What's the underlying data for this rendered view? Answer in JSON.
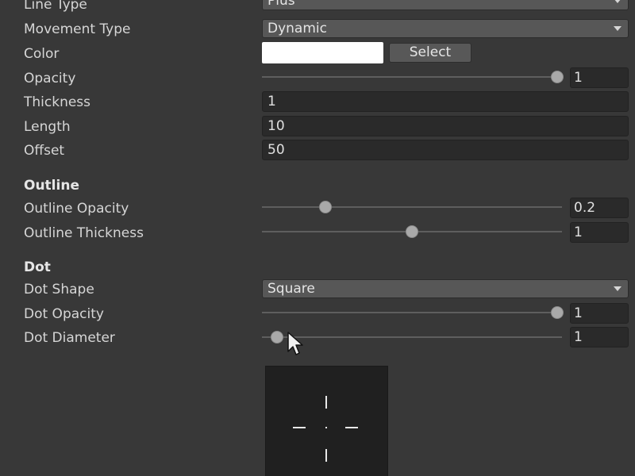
{
  "settings": {
    "line_type": {
      "label": "Line Type",
      "value": "Plus"
    },
    "movement_type": {
      "label": "Movement Type",
      "value": "Dynamic"
    },
    "color": {
      "label": "Color",
      "swatch": "#ffffff",
      "button": "Select"
    },
    "opacity": {
      "label": "Opacity",
      "value": "1",
      "level": 1.0
    },
    "thickness": {
      "label": "Thickness",
      "value": "1"
    },
    "length": {
      "label": "Length",
      "value": "10"
    },
    "offset": {
      "label": "Offset",
      "value": "50"
    }
  },
  "outline": {
    "heading": "Outline",
    "opacity": {
      "label": "Outline Opacity",
      "value": "0.2",
      "level": 0.2
    },
    "thickness": {
      "label": "Outline Thickness",
      "value": "1",
      "level": 0.5
    }
  },
  "dot": {
    "heading": "Dot",
    "shape": {
      "label": "Dot Shape",
      "value": "Square"
    },
    "opacity": {
      "label": "Dot Opacity",
      "value": "1",
      "level": 1.0
    },
    "diameter": {
      "label": "Dot Diameter",
      "value": "1",
      "level": 0.0
    }
  },
  "colors": {
    "background": "#383838",
    "preview_bg": "#202020",
    "crosshair": "#e8e8e8"
  }
}
